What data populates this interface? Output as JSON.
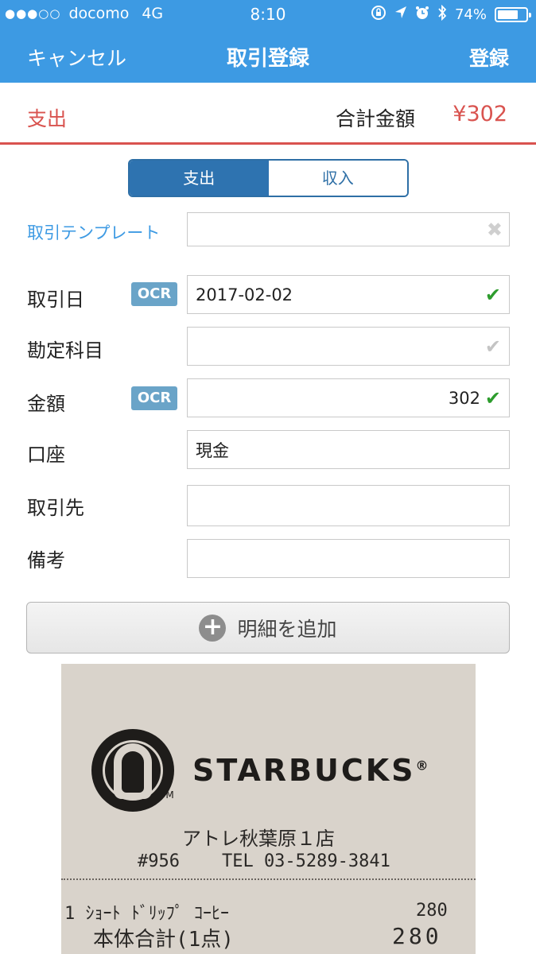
{
  "status_bar": {
    "signal_dots": "●●●○○",
    "carrier": "docomo",
    "network": "4G",
    "time": "8:10",
    "icons": [
      "rotation-lock-icon",
      "location-icon",
      "alarm-icon",
      "bluetooth-icon"
    ],
    "battery_text": "74%",
    "battery_level": 0.74
  },
  "nav": {
    "cancel_label": "キャンセル",
    "title": "取引登録",
    "save_label": "登録"
  },
  "summary": {
    "kind": "支出",
    "total_label": "合計金額",
    "total_value": "¥302"
  },
  "segment": {
    "options": [
      "支出",
      "収入"
    ],
    "selected": "支出"
  },
  "template": {
    "label": "取引テンプレート",
    "value": ""
  },
  "fields": {
    "date": {
      "label": "取引日",
      "ocr": "OCR",
      "value": "2017-02-02"
    },
    "account_item": {
      "label": "勘定科目",
      "value": ""
    },
    "amount": {
      "label": "金額",
      "ocr": "OCR",
      "value": "302"
    },
    "wallet": {
      "label": "口座",
      "value": "現金"
    },
    "partner": {
      "label": "取引先",
      "value": ""
    },
    "memo": {
      "label": "備考",
      "value": ""
    }
  },
  "add_detail_label": "明細を追加",
  "receipt": {
    "brand": "STARBUCKS",
    "registered": "®",
    "tm": "TM",
    "store": "アトレ秋葉原１店",
    "store_no_tel": "#956    TEL 03-5289-3841",
    "item_line": "1 ｼｮｰﾄ ﾄﾞﾘｯﾌﾟ ｺｰﾋｰ",
    "item_price": "280",
    "subtotal_label": "本体合計(1点)",
    "subtotal_value": "280"
  },
  "colors": {
    "nav_blue": "#3d9ae3",
    "expense_red": "#d9534f",
    "segment_blue": "#2e73b0",
    "check_green": "#2d9c2d",
    "ocr_badge": "#6aa4c8"
  }
}
